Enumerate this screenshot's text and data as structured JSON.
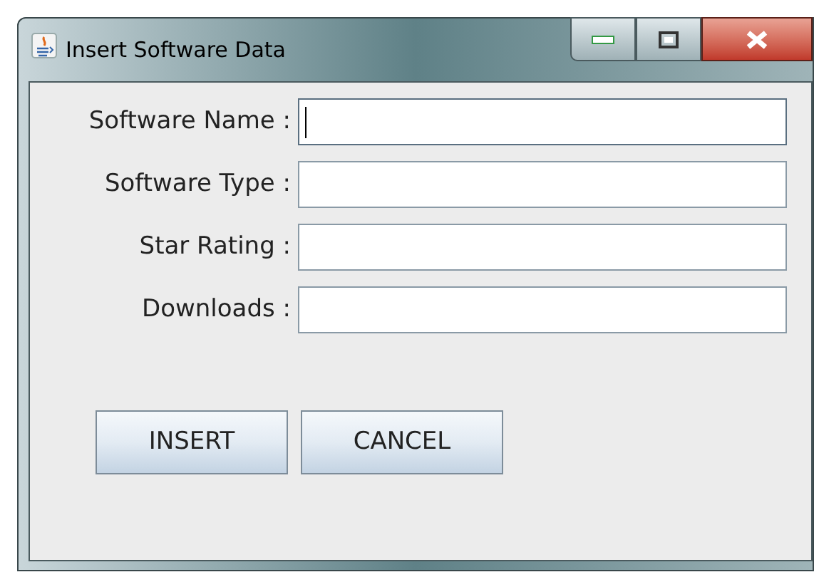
{
  "window": {
    "title": "Insert Software Data"
  },
  "fields": [
    {
      "label": "Software Name :",
      "focused": true
    },
    {
      "label": "Software Type :",
      "focused": false
    },
    {
      "label": "Star Rating :",
      "focused": false
    },
    {
      "label": "Downloads :",
      "focused": false
    }
  ],
  "buttons": [
    "INSERT",
    "CANCEL"
  ]
}
